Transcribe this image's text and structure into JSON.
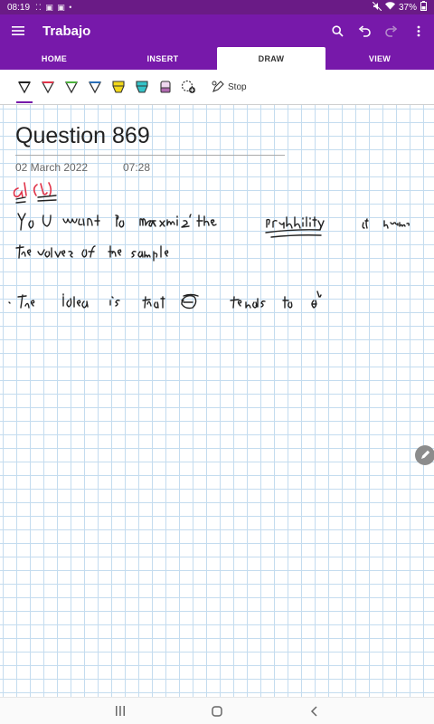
{
  "status": {
    "time": "08:19",
    "notif_icons": "⁚⁚ ▣ ▣ •",
    "battery": "37%"
  },
  "app": {
    "title": "Trabajo"
  },
  "tabs": [
    {
      "label": "HOME"
    },
    {
      "label": "INSERT"
    },
    {
      "label": "DRAW"
    },
    {
      "label": "VIEW"
    }
  ],
  "toolbar": {
    "stop_label": "Stop",
    "pen_colors": [
      "#222222",
      "#e0344a",
      "#4bb23c",
      "#2a6fb8",
      "#f2d81b",
      "#35c3c8",
      "#b06ab0"
    ]
  },
  "page": {
    "title": "Question 869",
    "date": "02 March 2022",
    "time": "07:28"
  },
  "accent": "#7719aa"
}
